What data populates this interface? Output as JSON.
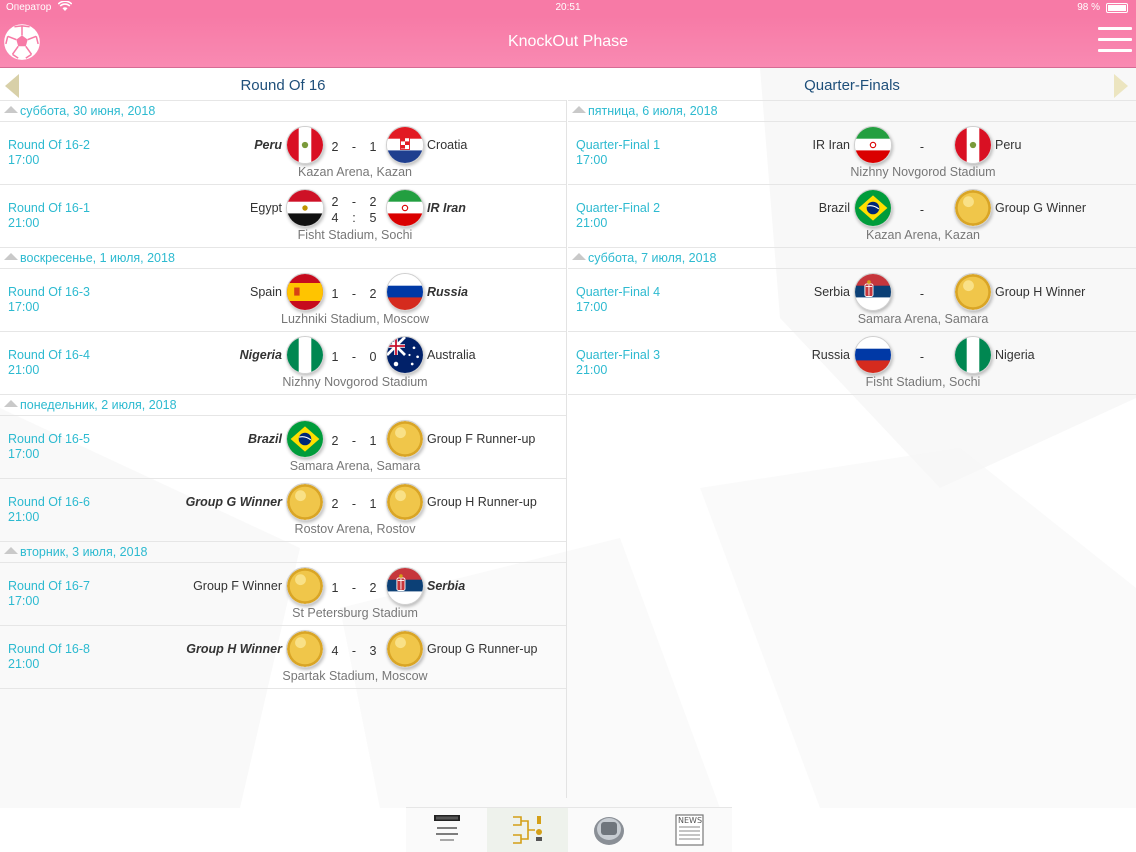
{
  "status": {
    "carrier": "Оператор",
    "time": "20:51",
    "battery": "98 %"
  },
  "nav": {
    "title": "KnockOut Phase"
  },
  "left": {
    "header": "Round Of 16",
    "days": [
      {
        "date": "суббота, 30 июня, 2018",
        "matches": [
          {
            "name": "Round Of 16-2",
            "time": "17:00",
            "home": "Peru",
            "away": "Croatia",
            "home_flag": "peru",
            "away_flag": "croatia",
            "s1": "2",
            "sep": "-",
            "s2": "1",
            "winner": "home",
            "venue": "Kazan Arena, Kazan"
          },
          {
            "name": "Round Of 16-1",
            "time": "21:00",
            "home": "Egypt",
            "away": "IR Iran",
            "home_flag": "egypt",
            "away_flag": "iran",
            "s1": "2",
            "sep": "-",
            "s2": "2",
            "p1": "4",
            "psep": ":",
            "p2": "5",
            "winner": "away",
            "venue": "Fisht Stadium, Sochi"
          }
        ]
      },
      {
        "date": "воскресенье, 1 июля, 2018",
        "matches": [
          {
            "name": "Round Of 16-3",
            "time": "17:00",
            "home": "Spain",
            "away": "Russia",
            "home_flag": "spain",
            "away_flag": "russia",
            "s1": "1",
            "sep": "-",
            "s2": "2",
            "winner": "away",
            "venue": "Luzhniki Stadium, Moscow"
          },
          {
            "name": "Round Of 16-4",
            "time": "21:00",
            "home": "Nigeria",
            "away": "Australia",
            "home_flag": "nigeria",
            "away_flag": "australia",
            "s1": "1",
            "sep": "-",
            "s2": "0",
            "winner": "home",
            "venue": "Nizhny Novgorod Stadium"
          }
        ]
      },
      {
        "date": "понедельник, 2 июля, 2018",
        "matches": [
          {
            "name": "Round Of 16-5",
            "time": "17:00",
            "home": "Brazil",
            "away": "Group F Runner-up",
            "home_flag": "brazil",
            "away_flag": "gold",
            "s1": "2",
            "sep": "-",
            "s2": "1",
            "winner": "home",
            "venue": "Samara Arena, Samara"
          },
          {
            "name": "Round Of 16-6",
            "time": "21:00",
            "home": "Group G Winner",
            "away": "Group H Runner-up",
            "home_flag": "gold",
            "away_flag": "gold",
            "s1": "2",
            "sep": "-",
            "s2": "1",
            "winner": "home",
            "venue": "Rostov Arena, Rostov"
          }
        ]
      },
      {
        "date": "вторник, 3 июля, 2018",
        "matches": [
          {
            "name": "Round Of 16-7",
            "time": "17:00",
            "home": "Group F Winner",
            "away": "Serbia",
            "home_flag": "gold",
            "away_flag": "serbia",
            "s1": "1",
            "sep": "-",
            "s2": "2",
            "winner": "away",
            "venue": "St Petersburg Stadium"
          },
          {
            "name": "Round Of 16-8",
            "time": "21:00",
            "home": "Group H Winner",
            "away": "Group G Runner-up",
            "home_flag": "gold",
            "away_flag": "gold",
            "s1": "4",
            "sep": "-",
            "s2": "3",
            "winner": "home",
            "venue": "Spartak Stadium, Moscow"
          }
        ]
      }
    ]
  },
  "right": {
    "header": "Quarter-Finals",
    "days": [
      {
        "date": "пятница, 6 июля, 2018",
        "matches": [
          {
            "name": "Quarter-Final 1",
            "time": "17:00",
            "home": "IR Iran",
            "away": "Peru",
            "home_flag": "iran",
            "away_flag": "peru",
            "s1": "",
            "sep": "-",
            "s2": "",
            "winner": "",
            "venue": "Nizhny Novgorod Stadium"
          },
          {
            "name": "Quarter-Final 2",
            "time": "21:00",
            "home": "Brazil",
            "away": "Group G Winner",
            "home_flag": "brazil",
            "away_flag": "gold",
            "s1": "",
            "sep": "-",
            "s2": "",
            "winner": "",
            "venue": "Kazan Arena, Kazan"
          }
        ]
      },
      {
        "date": "суббота, 7 июля, 2018",
        "matches": [
          {
            "name": "Quarter-Final 4",
            "time": "17:00",
            "home": "Serbia",
            "away": "Group H Winner",
            "home_flag": "serbia",
            "away_flag": "gold",
            "s1": "",
            "sep": "-",
            "s2": "",
            "winner": "",
            "venue": "Samara Arena, Samara"
          },
          {
            "name": "Quarter-Final 3",
            "time": "21:00",
            "home": "Russia",
            "away": "Nigeria",
            "home_flag": "russia",
            "away_flag": "nigeria",
            "s1": "",
            "sep": "-",
            "s2": "",
            "winner": "",
            "venue": "Fisht Stadium, Sochi"
          }
        ]
      }
    ]
  },
  "tabs": [
    {
      "name": "winner-tab",
      "icon": "trophy-board-icon"
    },
    {
      "name": "bracket-tab",
      "icon": "bracket-icon",
      "selected": true
    },
    {
      "name": "stadium-tab",
      "icon": "stadium-icon"
    },
    {
      "name": "news-tab",
      "icon": "news-icon"
    }
  ],
  "colors": {
    "accent": "#f77aa6",
    "link": "#2dbad0",
    "header_text": "#1e4f7a"
  }
}
